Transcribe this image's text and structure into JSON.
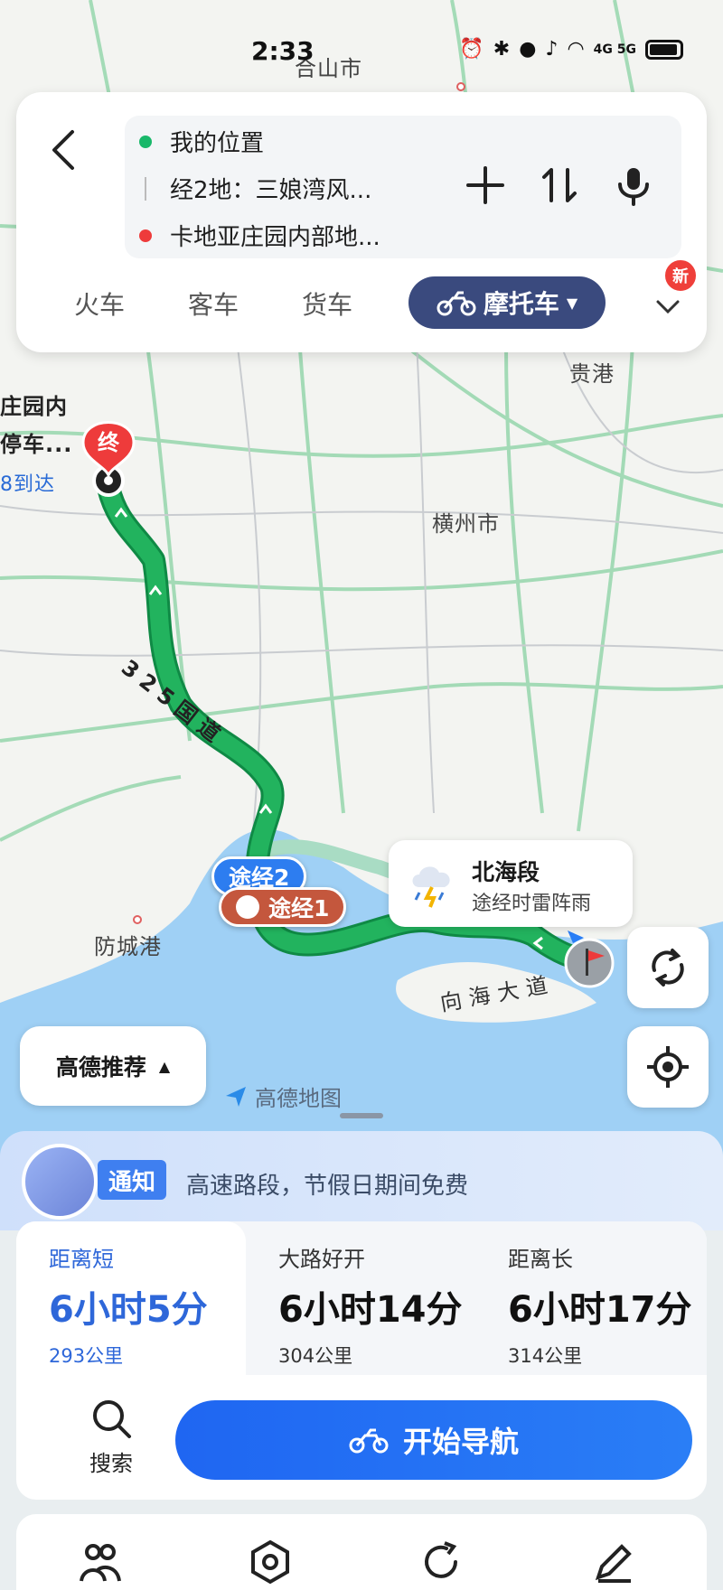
{
  "status_bar": {
    "time": "2:33",
    "network": "4G 5G"
  },
  "route": {
    "origin": "我的位置",
    "via_label": "经2地：三娘湾风...",
    "destination": "卡地亚庄园内部地..."
  },
  "modes": {
    "train": "火车",
    "bus": "客车",
    "truck": "货车",
    "motorcycle": "摩托车",
    "new_badge": "新"
  },
  "map": {
    "labels": {
      "city_top": "合山市",
      "guigang": "贵港",
      "hengzhou": "横州市",
      "fangchenggang": "防城港",
      "road_325": "325国道",
      "road_xianghai": "向海大道",
      "dest_name_line1": "庄园内",
      "dest_name_line2": "停车...",
      "dest_eta": "8到达"
    },
    "end_marker": "终",
    "via2": "途经2",
    "via1": "途经1",
    "weather": {
      "title": "北海段",
      "desc": "途经时雷阵雨"
    },
    "recommend": "高德推荐",
    "logo": "高德地图"
  },
  "notice": {
    "tag": "通知",
    "text": "高速路段，节假日期间免费"
  },
  "plans": [
    {
      "name": "距离短",
      "time": "6小时5分",
      "dist": "293公里"
    },
    {
      "name": "大路好开",
      "time": "6小时14分",
      "dist": "304公里"
    },
    {
      "name": "距离长",
      "time": "6小时17分",
      "dist": "314公里"
    }
  ],
  "actions": {
    "search": "搜索",
    "start": "开始导航"
  },
  "colors": {
    "route": "#1fae5a",
    "accent": "#2a6ff0",
    "mode_active": "#3a4a7e"
  }
}
